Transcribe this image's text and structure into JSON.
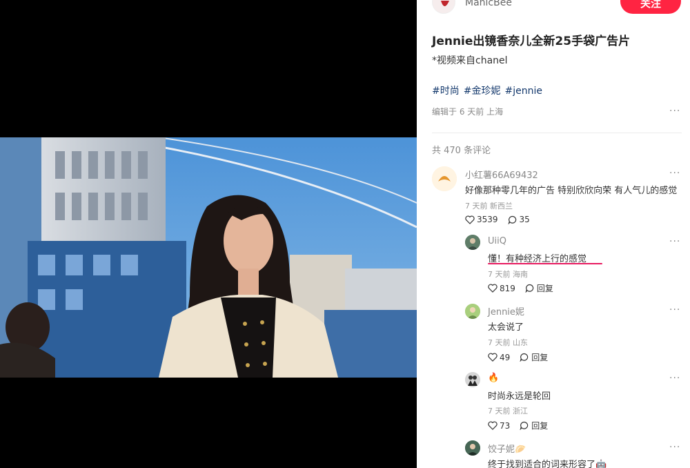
{
  "author": {
    "name": "ManicBee",
    "follow_label": "关注"
  },
  "post": {
    "title": "Jennie出镜香奈儿全新25手袋广告片",
    "description": "*视频来自chanel",
    "tags": [
      "#时尚",
      "#金珍妮",
      "#jennie"
    ],
    "meta": "编辑于 6 天前 上海"
  },
  "comments_count": "共 470 条评论",
  "comments": [
    {
      "user": "小红薯66A69432",
      "text": "好像那种零几年的广告 特别欣欣向荣 有人气儿的感觉",
      "meta": "7 天前 新西兰",
      "likes": "3539",
      "replies": "35"
    },
    {
      "user": "UiiQ",
      "text": "懂！有种经济上行的感觉",
      "meta": "7 天前 海南",
      "likes": "819",
      "reply_label": "回复"
    },
    {
      "user": "Jennie妮",
      "text": "太会说了",
      "meta": "7 天前 山东",
      "likes": "49",
      "reply_label": "回复"
    },
    {
      "user": "🔥",
      "text": "时尚永远是轮回",
      "meta": "7 天前 浙江",
      "likes": "73",
      "reply_label": "回复"
    },
    {
      "user": "饺子妮🥟",
      "text": "终于找到适合的词来形容了🤖"
    }
  ],
  "icons": {
    "like": "heart-outline-icon",
    "comment": "comment-bubble-icon",
    "more": "more-dots-icon"
  },
  "colors": {
    "follow": "#ff2442",
    "tag": "#13386c",
    "highlight_underline": "#e8195f"
  },
  "more_label": "···"
}
